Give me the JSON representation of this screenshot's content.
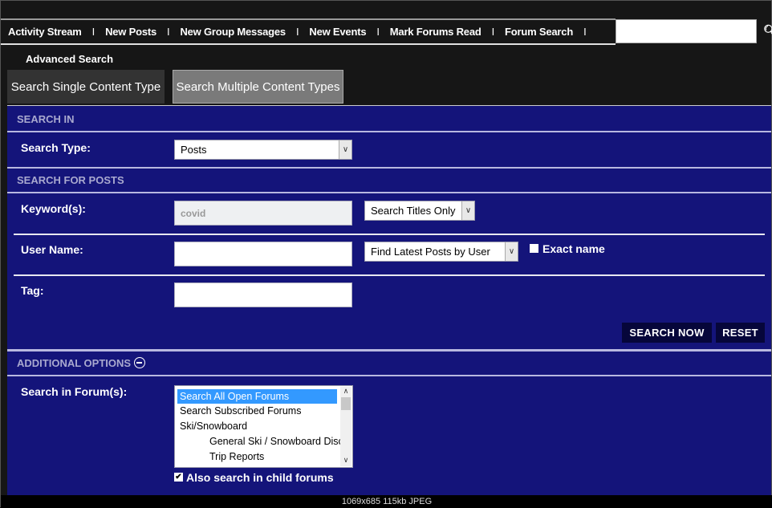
{
  "nav": {
    "items": [
      "Activity Stream",
      "New Posts",
      "New Group Messages",
      "New Events",
      "Mark Forums Read",
      "Forum Search"
    ],
    "separator": "I",
    "search_value": ""
  },
  "page_title": "Advanced Search",
  "tabs": [
    {
      "label": "Search Single Content Type",
      "active": true
    },
    {
      "label": "Search Multiple Content Types",
      "active": false
    }
  ],
  "sections": {
    "search_in": "SEARCH IN",
    "search_for_posts": "SEARCH FOR POSTS",
    "additional_options": "ADDITIONAL OPTIONS"
  },
  "form": {
    "search_type_label": "Search Type:",
    "search_type_value": "Posts",
    "keywords_label": "Keyword(s):",
    "keywords_value": "covid",
    "keywords_scope": "Search Titles Only",
    "username_label": "User Name:",
    "username_value": "",
    "username_mode": "Find Latest Posts by User",
    "exact_name_label": "Exact name",
    "exact_name_checked": false,
    "tag_label": "Tag:",
    "tag_value": "",
    "search_now": "SEARCH NOW",
    "reset": "RESET",
    "forums_label": "Search in Forum(s):",
    "forums": [
      "Search All Open Forums",
      "Search Subscribed Forums",
      "Ski/Snowboard",
      "General Ski / Snowboard Discussion",
      "Trip Reports"
    ],
    "child_forums_label": "Also search in child forums",
    "child_forums_checked": true
  },
  "caption": "1069x685 115kb JPEG",
  "colors": {
    "panel": "#14147a",
    "page": "#161616",
    "selected": "#3399ff"
  }
}
